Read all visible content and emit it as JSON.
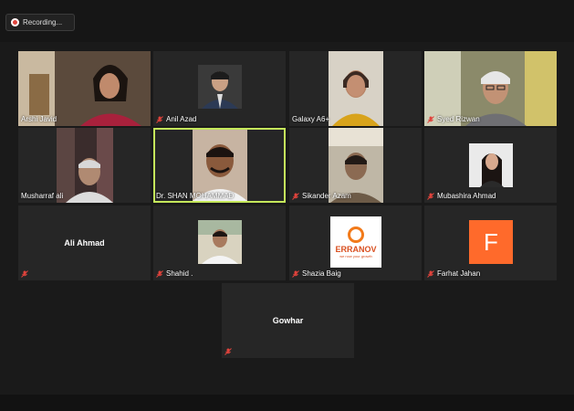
{
  "recording": {
    "label": "Recording..."
  },
  "participants": [
    {
      "name": "Arshi Javid",
      "muted": false
    },
    {
      "name": "Anil Azad",
      "muted": true
    },
    {
      "name": "Galaxy A6+",
      "muted": false
    },
    {
      "name": "Syed Rizwan",
      "muted": true
    },
    {
      "name": "Musharraf ali",
      "muted": false
    },
    {
      "name": "Dr. SHAN MOHAMMAD",
      "muted": false,
      "active_speaker": true
    },
    {
      "name": "Sikander Azam",
      "muted": true
    },
    {
      "name": "Mubashira Ahmad",
      "muted": true
    },
    {
      "name": "Ali Ahmad",
      "muted": true,
      "display": "Ali Ahmad"
    },
    {
      "name": "Shahid .",
      "muted": true
    },
    {
      "name": "Shazia Baig",
      "muted": true,
      "logo": {
        "brand": "ERRANOV",
        "tagline": "we now your growth"
      }
    },
    {
      "name": "Farhat Jahan",
      "muted": true,
      "avatar_letter": "F"
    },
    {
      "name": "Gowhar",
      "muted": true,
      "display": "Gowhar"
    }
  ],
  "colors": {
    "active_border": "#c5e85b",
    "mute_icon": "#e0433c",
    "avatar_bg": "#ff6a2b"
  }
}
